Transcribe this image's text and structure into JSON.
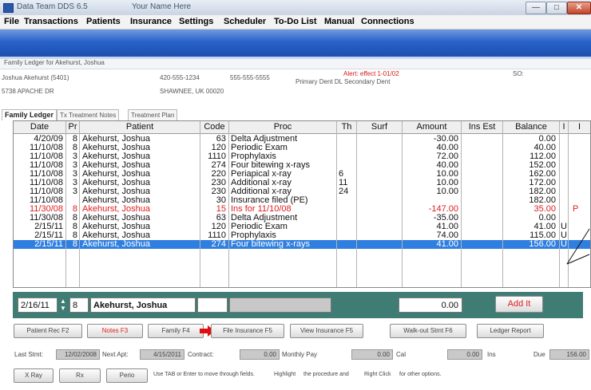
{
  "window": {
    "title": "Data Team DDS 6.5",
    "subtitle": "Your Name Here"
  },
  "menu": [
    "File",
    "Transactions",
    "Patients",
    "Insurance",
    "Settings",
    "Scheduler",
    "To-Do List",
    "Manual",
    "Connections"
  ],
  "inner_title": "Family Ledger for Akehurst, Joshua",
  "patient": {
    "name": "Joshua Akehurst (5401)",
    "phone": "420-555-1234",
    "phone2": "555-555-5555",
    "address": "5738 APACHE DR",
    "city": "SHAWNEE, UK 00020",
    "alert": "Alert: effect 1-01/02",
    "primary": "Primary Dent DL  Secondary Dent",
    "so_label": "SO:"
  },
  "tabs": [
    "Family Ledger",
    "Tx Treatment Notes",
    "Treatment Plan"
  ],
  "ledger": {
    "columns": [
      "Date",
      "Pr",
      "Patient",
      "Code",
      "Proc",
      "Th",
      "Surf",
      "Amount",
      "Ins Est",
      "Balance",
      "I",
      "I"
    ],
    "rows": [
      {
        "date": "4/20/09",
        "pr": "8",
        "patient": "Akehurst, Joshua",
        "code": "63",
        "proc": "Delta  Adjustment",
        "th": "",
        "surf": "",
        "amount": "-30.00",
        "ins": "",
        "balance": "0.00",
        "flag": "",
        "style": ""
      },
      {
        "date": "11/10/08",
        "pr": "8",
        "patient": "Akehurst, Joshua",
        "code": "120",
        "proc": "Periodic Exam",
        "th": "",
        "surf": "",
        "amount": "40.00",
        "ins": "",
        "balance": "40.00",
        "flag": "",
        "style": ""
      },
      {
        "date": "11/10/08",
        "pr": "3",
        "patient": "Akehurst, Joshua",
        "code": "1110",
        "proc": "Prophylaxis",
        "th": "",
        "surf": "",
        "amount": "72.00",
        "ins": "",
        "balance": "112.00",
        "flag": "",
        "style": ""
      },
      {
        "date": "11/10/08",
        "pr": "3",
        "patient": "Akehurst, Joshua",
        "code": "274",
        "proc": "Four bitewing x-rays",
        "th": "",
        "surf": "",
        "amount": "40.00",
        "ins": "",
        "balance": "152.00",
        "flag": "",
        "style": ""
      },
      {
        "date": "11/10/08",
        "pr": "3",
        "patient": "Akehurst, Joshua",
        "code": "220",
        "proc": "Periapical x-ray",
        "th": "6",
        "surf": "",
        "amount": "10.00",
        "ins": "",
        "balance": "162.00",
        "flag": "",
        "style": ""
      },
      {
        "date": "11/10/08",
        "pr": "3",
        "patient": "Akehurst, Joshua",
        "code": "230",
        "proc": "Additional x-ray",
        "th": "11",
        "surf": "",
        "amount": "10.00",
        "ins": "",
        "balance": "172.00",
        "flag": "",
        "style": ""
      },
      {
        "date": "11/10/08",
        "pr": "3",
        "patient": "Akehurst, Joshua",
        "code": "230",
        "proc": "Additional x-ray",
        "th": "24",
        "surf": "",
        "amount": "10.00",
        "ins": "",
        "balance": "182.00",
        "flag": "",
        "style": ""
      },
      {
        "date": "11/10/08",
        "pr": "",
        "patient": "Akehurst, Joshua",
        "code": "30",
        "proc": "Insurance filed (PE)",
        "th": "",
        "surf": "",
        "amount": "",
        "ins": "",
        "balance": "182.00",
        "flag": "",
        "style": ""
      },
      {
        "date": "11/30/08",
        "pr": "8",
        "patient": "Akehurst, Joshua",
        "code": "15",
        "proc": "Ins for 11/10/08",
        "th": "",
        "surf": "",
        "amount": "-147.00",
        "ins": "",
        "balance": "35.00",
        "flag": "P",
        "style": "red"
      },
      {
        "date": "11/30/08",
        "pr": "8",
        "patient": "Akehurst, Joshua",
        "code": "63",
        "proc": "Delta  Adjustment",
        "th": "",
        "surf": "",
        "amount": "-35.00",
        "ins": "",
        "balance": "0.00",
        "flag": "",
        "style": ""
      },
      {
        "date": "2/15/11",
        "pr": "8",
        "patient": "Akehurst, Joshua",
        "code": "120",
        "proc": "Periodic Exam",
        "th": "",
        "surf": "",
        "amount": "41.00",
        "ins": "",
        "balance": "41.00",
        "flag": "U",
        "style": ""
      },
      {
        "date": "2/15/11",
        "pr": "8",
        "patient": "Akehurst, Joshua",
        "code": "1110",
        "proc": "Prophylaxis",
        "th": "",
        "surf": "",
        "amount": "74.00",
        "ins": "",
        "balance": "115.00",
        "flag": "U",
        "style": ""
      },
      {
        "date": "2/15/11",
        "pr": "8",
        "patient": "Akehurst, Joshua",
        "code": "274",
        "proc": "Four bitewing x-rays",
        "th": "",
        "surf": "",
        "amount": "41.00",
        "ins": "",
        "balance": "156.00",
        "flag": "U",
        "style": "sel"
      }
    ]
  },
  "entry": {
    "date": "2/16/11",
    "provider": "8",
    "patient": "Akehurst, Joshua",
    "amount": "0.00",
    "add_label": "Add It"
  },
  "buttons": [
    "Patient Rec F2",
    "Notes F3",
    "Family F4",
    "File Insurance F5",
    "View Insurance F5",
    "Walk-out Stmt F6",
    "Ledger Report"
  ],
  "footer": {
    "last_stmt_label": "Last Stmt:",
    "last_stmt": "12/02/2008",
    "next_apt_label": "Next Apt:",
    "next_apt": "4/15/2011",
    "contract_label": "Contract:",
    "contract": "0.00",
    "monthly_label": "Monthly Pay",
    "monthly": "0.00",
    "cal_label": "Cal",
    "cal": "0.00",
    "ins_label": "Ins",
    "due_label": "Due",
    "due": "156.00"
  },
  "bottom": {
    "xray": "X Ray",
    "rx": "Rx",
    "perio": "Perio",
    "hint1": "Use TAB or Enter to move through fields.",
    "hint_highlight": "Highlight",
    "hint2": "the procedure and",
    "hint_right": "Right Click",
    "hint3": "for other options."
  },
  "colors": {
    "banner": "#2a62c9",
    "selected_row": "#2f7fe0",
    "entry_panel": "#3f7d74",
    "alert_red": "#e01d1d",
    "arrow": "#e01010"
  }
}
